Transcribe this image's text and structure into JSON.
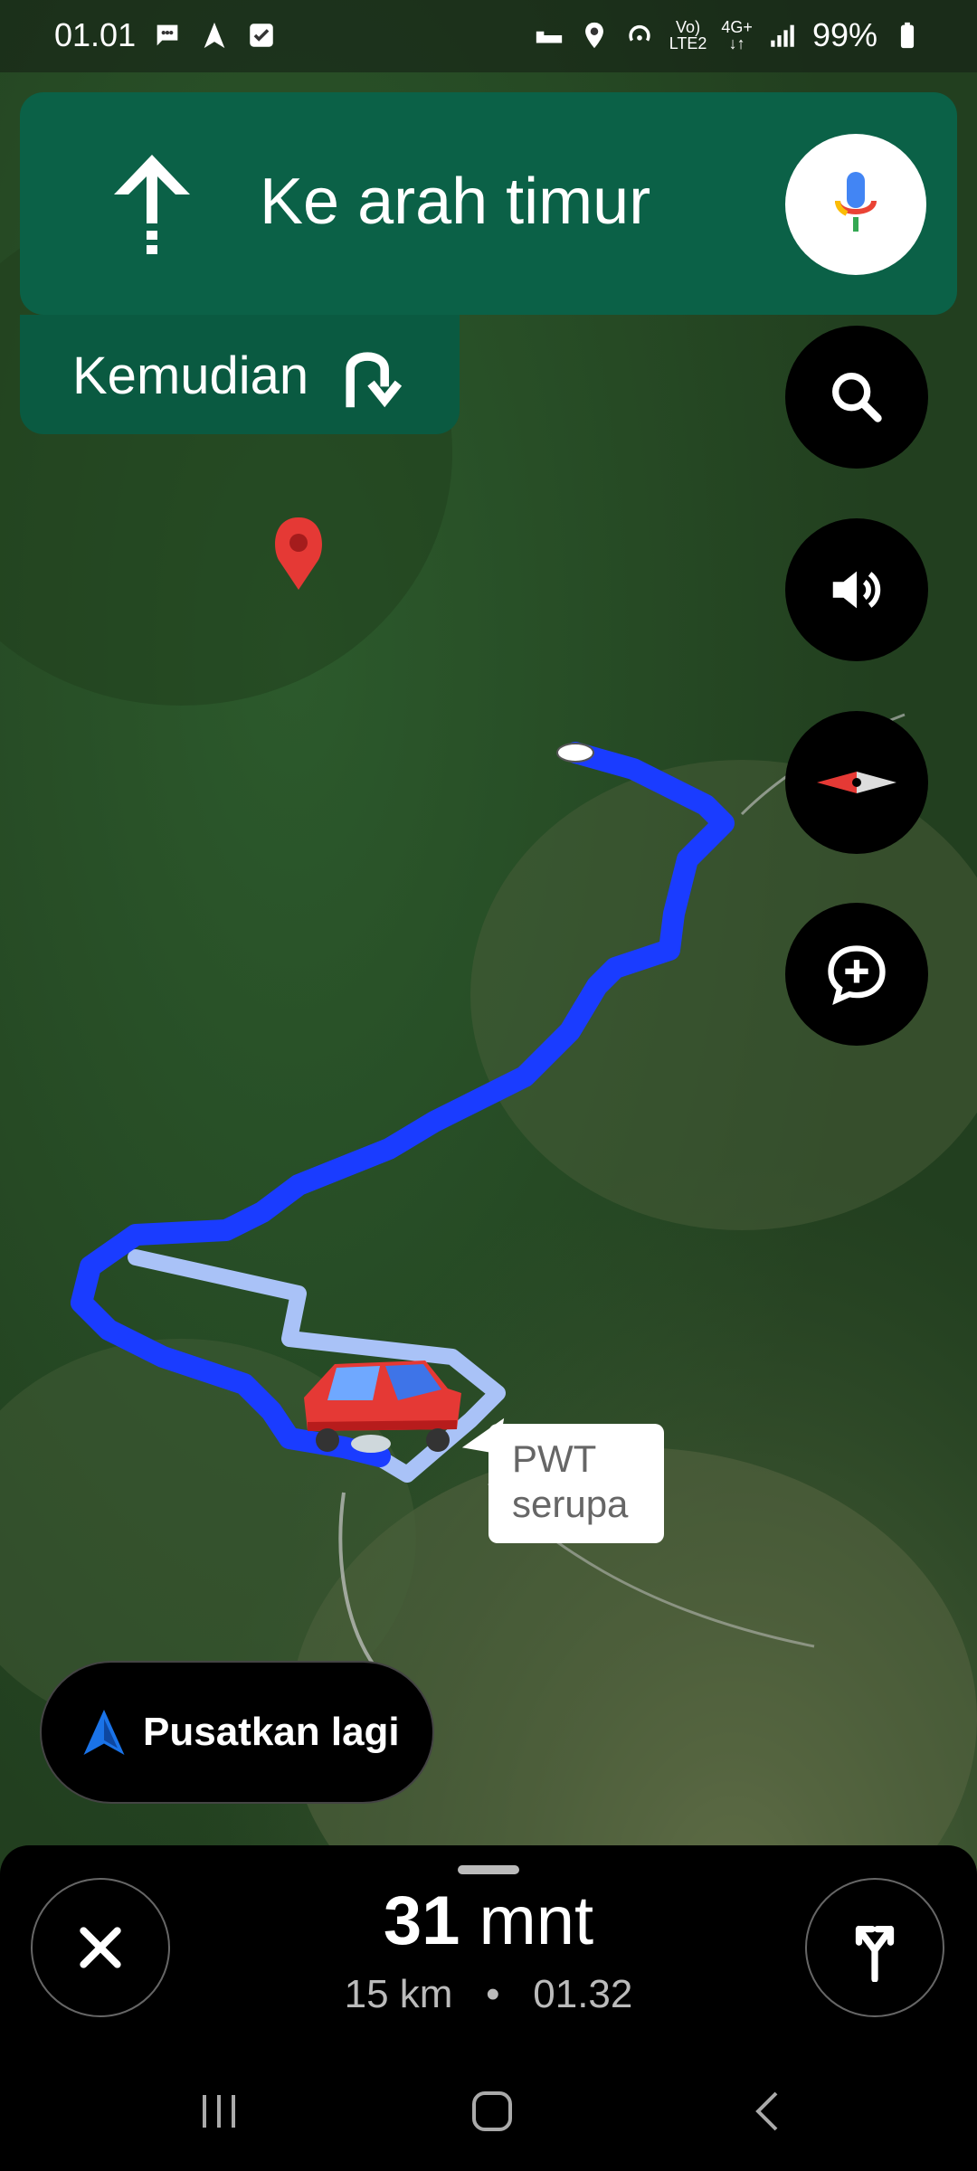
{
  "status_bar": {
    "time": "01.01",
    "battery": "99%",
    "net_lte": "LTE2",
    "net_4g": "4G+"
  },
  "navigation": {
    "instruction": "Ke arah timur",
    "then_label": "Kemudian"
  },
  "callout": {
    "line1": "PWT",
    "line2": "serupa"
  },
  "recenter": {
    "label": "Pusatkan lagi"
  },
  "trip": {
    "duration_value": "31",
    "duration_unit": "mnt",
    "distance": "15 km",
    "separator": "•",
    "arrival": "01.32"
  },
  "colors": {
    "banner": "#0b6147",
    "route": "#1a3cff",
    "route_alt": "#a9c2f7",
    "pin": "#e53935"
  },
  "icons": {
    "go_straight": "arrow-up-icon",
    "turn": "u-turn-right-icon",
    "mic": "mic-icon",
    "search": "search-icon",
    "sound": "volume-icon",
    "compass": "compass-icon",
    "report": "add-report-icon",
    "close": "close-icon",
    "alternates": "route-options-icon"
  }
}
